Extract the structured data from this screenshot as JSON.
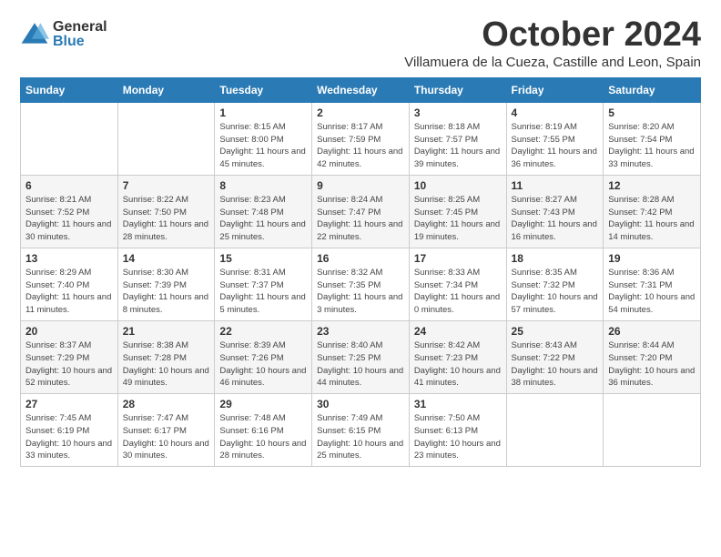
{
  "logo": {
    "general": "General",
    "blue": "Blue"
  },
  "title": "October 2024",
  "location": "Villamuera de la Cueza, Castille and Leon, Spain",
  "days_of_week": [
    "Sunday",
    "Monday",
    "Tuesday",
    "Wednesday",
    "Thursday",
    "Friday",
    "Saturday"
  ],
  "weeks": [
    [
      {
        "day": "",
        "info": ""
      },
      {
        "day": "",
        "info": ""
      },
      {
        "day": "1",
        "info": "Sunrise: 8:15 AM\nSunset: 8:00 PM\nDaylight: 11 hours and 45 minutes."
      },
      {
        "day": "2",
        "info": "Sunrise: 8:17 AM\nSunset: 7:59 PM\nDaylight: 11 hours and 42 minutes."
      },
      {
        "day": "3",
        "info": "Sunrise: 8:18 AM\nSunset: 7:57 PM\nDaylight: 11 hours and 39 minutes."
      },
      {
        "day": "4",
        "info": "Sunrise: 8:19 AM\nSunset: 7:55 PM\nDaylight: 11 hours and 36 minutes."
      },
      {
        "day": "5",
        "info": "Sunrise: 8:20 AM\nSunset: 7:54 PM\nDaylight: 11 hours and 33 minutes."
      }
    ],
    [
      {
        "day": "6",
        "info": "Sunrise: 8:21 AM\nSunset: 7:52 PM\nDaylight: 11 hours and 30 minutes."
      },
      {
        "day": "7",
        "info": "Sunrise: 8:22 AM\nSunset: 7:50 PM\nDaylight: 11 hours and 28 minutes."
      },
      {
        "day": "8",
        "info": "Sunrise: 8:23 AM\nSunset: 7:48 PM\nDaylight: 11 hours and 25 minutes."
      },
      {
        "day": "9",
        "info": "Sunrise: 8:24 AM\nSunset: 7:47 PM\nDaylight: 11 hours and 22 minutes."
      },
      {
        "day": "10",
        "info": "Sunrise: 8:25 AM\nSunset: 7:45 PM\nDaylight: 11 hours and 19 minutes."
      },
      {
        "day": "11",
        "info": "Sunrise: 8:27 AM\nSunset: 7:43 PM\nDaylight: 11 hours and 16 minutes."
      },
      {
        "day": "12",
        "info": "Sunrise: 8:28 AM\nSunset: 7:42 PM\nDaylight: 11 hours and 14 minutes."
      }
    ],
    [
      {
        "day": "13",
        "info": "Sunrise: 8:29 AM\nSunset: 7:40 PM\nDaylight: 11 hours and 11 minutes."
      },
      {
        "day": "14",
        "info": "Sunrise: 8:30 AM\nSunset: 7:39 PM\nDaylight: 11 hours and 8 minutes."
      },
      {
        "day": "15",
        "info": "Sunrise: 8:31 AM\nSunset: 7:37 PM\nDaylight: 11 hours and 5 minutes."
      },
      {
        "day": "16",
        "info": "Sunrise: 8:32 AM\nSunset: 7:35 PM\nDaylight: 11 hours and 3 minutes."
      },
      {
        "day": "17",
        "info": "Sunrise: 8:33 AM\nSunset: 7:34 PM\nDaylight: 11 hours and 0 minutes."
      },
      {
        "day": "18",
        "info": "Sunrise: 8:35 AM\nSunset: 7:32 PM\nDaylight: 10 hours and 57 minutes."
      },
      {
        "day": "19",
        "info": "Sunrise: 8:36 AM\nSunset: 7:31 PM\nDaylight: 10 hours and 54 minutes."
      }
    ],
    [
      {
        "day": "20",
        "info": "Sunrise: 8:37 AM\nSunset: 7:29 PM\nDaylight: 10 hours and 52 minutes."
      },
      {
        "day": "21",
        "info": "Sunrise: 8:38 AM\nSunset: 7:28 PM\nDaylight: 10 hours and 49 minutes."
      },
      {
        "day": "22",
        "info": "Sunrise: 8:39 AM\nSunset: 7:26 PM\nDaylight: 10 hours and 46 minutes."
      },
      {
        "day": "23",
        "info": "Sunrise: 8:40 AM\nSunset: 7:25 PM\nDaylight: 10 hours and 44 minutes."
      },
      {
        "day": "24",
        "info": "Sunrise: 8:42 AM\nSunset: 7:23 PM\nDaylight: 10 hours and 41 minutes."
      },
      {
        "day": "25",
        "info": "Sunrise: 8:43 AM\nSunset: 7:22 PM\nDaylight: 10 hours and 38 minutes."
      },
      {
        "day": "26",
        "info": "Sunrise: 8:44 AM\nSunset: 7:20 PM\nDaylight: 10 hours and 36 minutes."
      }
    ],
    [
      {
        "day": "27",
        "info": "Sunrise: 7:45 AM\nSunset: 6:19 PM\nDaylight: 10 hours and 33 minutes."
      },
      {
        "day": "28",
        "info": "Sunrise: 7:47 AM\nSunset: 6:17 PM\nDaylight: 10 hours and 30 minutes."
      },
      {
        "day": "29",
        "info": "Sunrise: 7:48 AM\nSunset: 6:16 PM\nDaylight: 10 hours and 28 minutes."
      },
      {
        "day": "30",
        "info": "Sunrise: 7:49 AM\nSunset: 6:15 PM\nDaylight: 10 hours and 25 minutes."
      },
      {
        "day": "31",
        "info": "Sunrise: 7:50 AM\nSunset: 6:13 PM\nDaylight: 10 hours and 23 minutes."
      },
      {
        "day": "",
        "info": ""
      },
      {
        "day": "",
        "info": ""
      }
    ]
  ]
}
